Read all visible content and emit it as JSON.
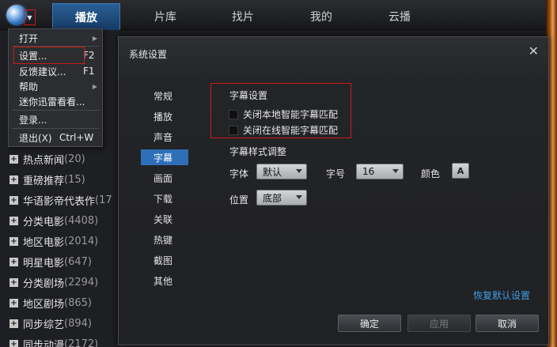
{
  "tabs": [
    "播放",
    "片库",
    "找片",
    "我的",
    "云播"
  ],
  "menu": {
    "items": [
      {
        "label": "打开",
        "shortcut": "",
        "submenu": true
      },
      {
        "label": "设置...",
        "shortcut": "F2",
        "submenu": false
      },
      {
        "label": "反馈建议...",
        "shortcut": "F1",
        "submenu": false
      },
      {
        "label": "帮助",
        "shortcut": "",
        "submenu": true
      },
      {
        "label": "迷你迅雷看看...",
        "shortcut": "",
        "submenu": false
      },
      {
        "label": "登录...",
        "shortcut": "",
        "submenu": false
      },
      {
        "label": "退出(X)",
        "shortcut": "Ctrl+W",
        "submenu": false
      }
    ]
  },
  "left_list": [
    {
      "name": "热点新闻",
      "count": "(20)"
    },
    {
      "name": "重磅推荐",
      "count": "(15)"
    },
    {
      "name": "华语影帝代表作",
      "count": "(17"
    },
    {
      "name": "分类电影",
      "count": "(4408)"
    },
    {
      "name": "地区电影",
      "count": "(2014)"
    },
    {
      "name": "明星电影",
      "count": "(647)"
    },
    {
      "name": "分类剧场",
      "count": "(2294)"
    },
    {
      "name": "地区剧场",
      "count": "(865)"
    },
    {
      "name": "同步综艺",
      "count": "(894)"
    },
    {
      "name": "同步动漫",
      "count": "(2172)"
    }
  ],
  "dialog": {
    "title": "系统设置",
    "close": "✕",
    "nav": [
      "常规",
      "播放",
      "声音",
      "字幕",
      "画面",
      "下载",
      "关联",
      "热键",
      "截图",
      "其他"
    ],
    "active_nav": 3,
    "subtitle_section": {
      "title": "字幕设置",
      "options": [
        "关闭本地智能字幕匹配",
        "关闭在线智能字幕匹配"
      ]
    },
    "style_section": {
      "title": "字幕样式调整",
      "font_label": "字体",
      "font_value": "默认",
      "size_label": "字号",
      "size_value": "16",
      "color_label": "颜色",
      "color_icon": "A",
      "position_label": "位置",
      "position_value": "底部"
    },
    "restore_link": "恢复默认设置",
    "buttons": {
      "ok": "确定",
      "apply": "应用",
      "cancel": "取消"
    }
  }
}
